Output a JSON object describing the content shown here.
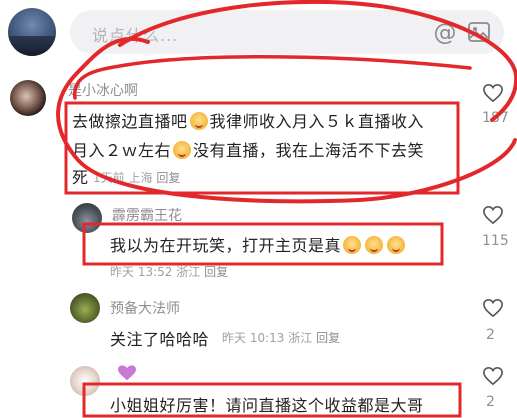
{
  "input": {
    "placeholder": "说点什么..."
  },
  "icons": {
    "at": "at-sign-icon",
    "image": "image-icon",
    "like": "heart-outline-icon"
  },
  "comments": [
    {
      "username": "是小冰心啊",
      "text_line1_a": "去做擦边直播吧",
      "text_line1_b": "我律师收入月入５ｋ直播收入",
      "text_line2_a": "月入２ｗ左右",
      "text_line2_b": "没有直播，我在上海活不下去笑",
      "text_line3": "死",
      "time": "1天前",
      "location": "上海",
      "reply": "回复",
      "likes": "187"
    },
    {
      "username": "霹雳霸王花",
      "text": "我以为在开玩笑，打开主页是真",
      "time": "昨天 13:52",
      "location": "浙江",
      "reply": "回复",
      "likes": "115"
    },
    {
      "username": "预备大法师",
      "text": "关注了哈哈哈",
      "time": "昨天 10:13",
      "location": "浙江",
      "reply": "回复",
      "likes": "2"
    },
    {
      "username": "",
      "text": "小姐姐好厉害！请问直播这个收益都是大哥",
      "likes": "2"
    }
  ],
  "annotation_color": "#e3282c"
}
